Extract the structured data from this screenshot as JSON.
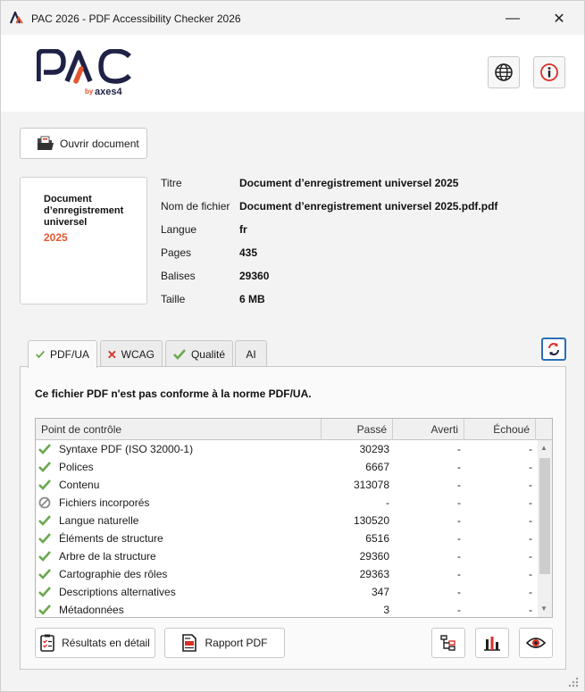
{
  "window": {
    "title": "PAC 2026 - PDF Accessibility Checker 2026",
    "minimize_glyph": "—",
    "close_glyph": "✕"
  },
  "logo": {
    "brand": "PAC",
    "tagline_by": "by",
    "tagline_axes": "axes4"
  },
  "toolbar": {
    "open_label": "Ouvrir document"
  },
  "document": {
    "card_title": "Document d’enregistrement universel",
    "card_year": "2025",
    "fields": [
      {
        "label": "Titre",
        "value": "Document d’enregistrement universel 2025"
      },
      {
        "label": "Nom de fichier",
        "value": "Document d’enregistrement universel 2025.pdf.pdf"
      },
      {
        "label": "Langue",
        "value": "fr"
      },
      {
        "label": "Pages",
        "value": "435"
      },
      {
        "label": "Balises",
        "value": "29360"
      },
      {
        "label": "Taille",
        "value": "6 MB"
      }
    ]
  },
  "tabs": [
    {
      "label": "PDF/UA",
      "status": "pass"
    },
    {
      "label": "WCAG",
      "status": "fail"
    },
    {
      "label": "Qualité",
      "status": "pass"
    },
    {
      "label": "AI",
      "status": "none"
    }
  ],
  "result": {
    "message": "Ce fichier PDF n'est pas conforme à la norme PDF/UA.",
    "columns": [
      "Point de contrôle",
      "Passé",
      "Averti",
      "Échoué"
    ],
    "rows": [
      {
        "status": "pass",
        "name": "Syntaxe PDF (ISO 32000-1)",
        "passed": "30293",
        "warned": "-",
        "failed": "-"
      },
      {
        "status": "pass",
        "name": "Polices",
        "passed": "6667",
        "warned": "-",
        "failed": "-"
      },
      {
        "status": "pass",
        "name": "Contenu",
        "passed": "313078",
        "warned": "-",
        "failed": "-"
      },
      {
        "status": "na",
        "name": "Fichiers incorporés",
        "passed": "-",
        "warned": "-",
        "failed": "-"
      },
      {
        "status": "pass",
        "name": "Langue naturelle",
        "passed": "130520",
        "warned": "-",
        "failed": "-"
      },
      {
        "status": "pass",
        "name": "Éléments de structure",
        "passed": "6516",
        "warned": "-",
        "failed": "-"
      },
      {
        "status": "pass",
        "name": "Arbre de la structure",
        "passed": "29360",
        "warned": "-",
        "failed": "-"
      },
      {
        "status": "pass",
        "name": "Cartographie des rôles",
        "passed": "29363",
        "warned": "-",
        "failed": "-"
      },
      {
        "status": "pass",
        "name": "Descriptions alternatives",
        "passed": "347",
        "warned": "-",
        "failed": "-"
      },
      {
        "status": "pass",
        "name": "Métadonnées",
        "passed": "3",
        "warned": "-",
        "failed": "-"
      }
    ]
  },
  "actions": {
    "details_label": "Résultats en détail",
    "report_label": "Rapport PDF"
  },
  "colors": {
    "pass": "#6aa84f",
    "fail": "#d93025",
    "accent": "#2a6fb8",
    "brand_orange": "#e4572e",
    "logo_navy": "#1f2246"
  }
}
